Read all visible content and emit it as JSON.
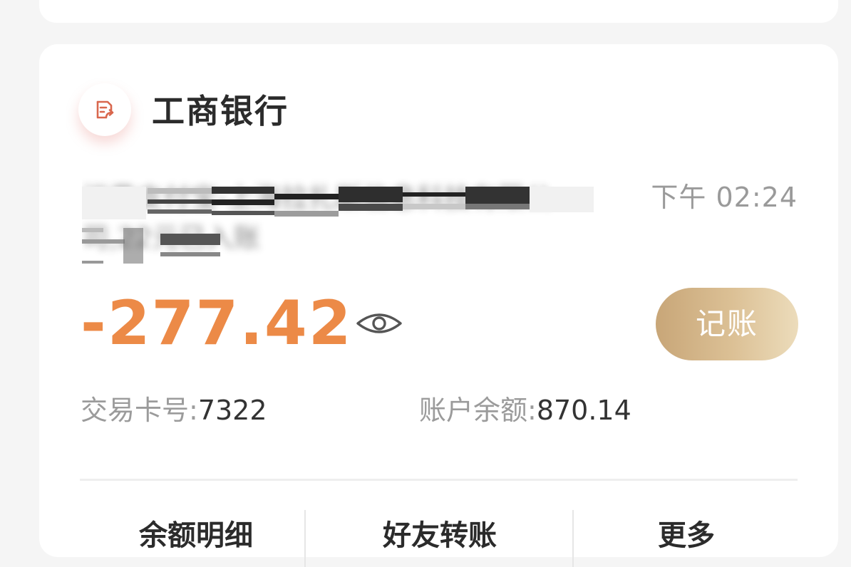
{
  "bank": {
    "name": "工商银行",
    "icon": "transfer-document-icon",
    "icon_color": "#d9674d"
  },
  "transaction": {
    "description": "消费支付宝-上海拉扎斯信息科技有限公司,22元已入账",
    "time": "下午 02:24",
    "amount": "-277.42",
    "amount_color": "#ec8a47",
    "card_label": "交易卡号:",
    "card_number": "7322",
    "balance_label": "账户余额:",
    "balance": "870.14"
  },
  "buttons": {
    "record_label": "记账",
    "visibility_icon": "eye-icon"
  },
  "actions": [
    {
      "label": "余额明细"
    },
    {
      "label": "好友转账"
    },
    {
      "label": "更多"
    }
  ]
}
